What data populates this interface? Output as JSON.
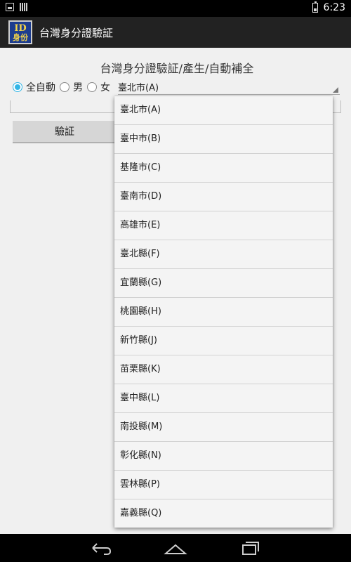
{
  "status": {
    "time": "6:23"
  },
  "app": {
    "icon_line1": "ID",
    "icon_line2": "身份",
    "title": "台灣身分證驗証"
  },
  "main": {
    "heading": "台灣身分證驗証/產生/自動補全",
    "radios": [
      {
        "label": "全自動",
        "checked": true
      },
      {
        "label": "男",
        "checked": false
      },
      {
        "label": "女",
        "checked": false
      }
    ],
    "spinner_value": "臺北市(A)",
    "id_input": {
      "value": "",
      "placeholder": ""
    },
    "verify_label": "驗証"
  },
  "dropdown": {
    "items": [
      "臺北市(A)",
      "臺中市(B)",
      "基隆市(C)",
      "臺南市(D)",
      "高雄市(E)",
      "臺北縣(F)",
      "宜蘭縣(G)",
      "桃園縣(H)",
      "新竹縣(J)",
      "苗栗縣(K)",
      "臺中縣(L)",
      "南投縣(M)",
      "彰化縣(N)",
      "雲林縣(P)",
      "嘉義縣(Q)"
    ]
  },
  "colors": {
    "accent": "#33b5e5",
    "actionbar": "#222222",
    "app_icon_bg": "#1d3d8f"
  }
}
